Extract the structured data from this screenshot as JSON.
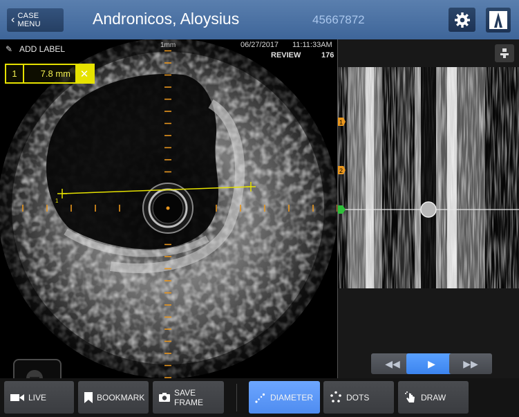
{
  "header": {
    "case_menu_label": "CASE MENU",
    "patient_name": "Andronicos, Aloysius",
    "patient_id": "45667872"
  },
  "image_view": {
    "add_label": "ADD LABEL",
    "scale": "1mm",
    "date": "06/27/2017",
    "time": "11:11:33AM",
    "mode": "REVIEW",
    "frame": "176",
    "measurement": {
      "index": "1",
      "value": "7.8 mm"
    },
    "marker_colors": {
      "measure": "#e6e200",
      "ticks": "#e8961e",
      "bookmark_green": "#2fbf3a"
    }
  },
  "lmode": {
    "bookmarks": [
      "1",
      "2"
    ]
  },
  "transport": {
    "rewind_icon": "rewind-icon",
    "play_icon": "play-icon",
    "fast_forward_icon": "fast-forward-icon"
  },
  "toolbar": {
    "live": "LIVE",
    "bookmark": "BOOKMARK",
    "save_frame": "SAVE FRAME",
    "diameter": "DIAMETER",
    "dots": "DOTS",
    "draw": "DRAW",
    "active_tool": "DIAMETER"
  },
  "colors": {
    "header": "#4a71a3",
    "accent": "#5a9cff",
    "patient_id": "#a9c6ec"
  }
}
